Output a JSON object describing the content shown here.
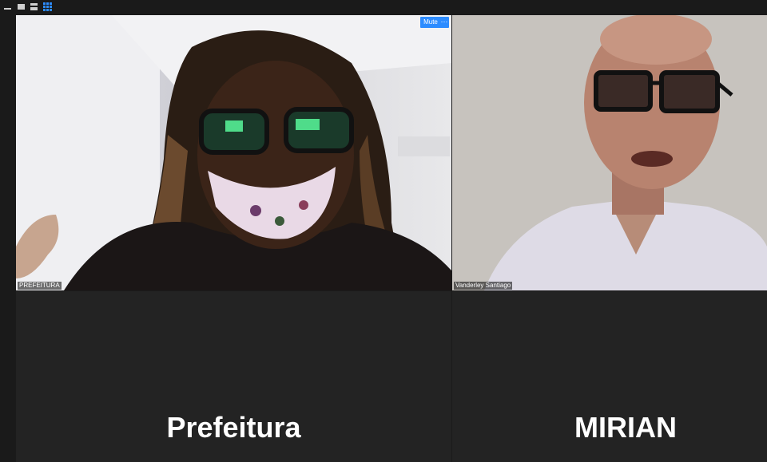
{
  "toolbar": {
    "icons": [
      "minimize-icon",
      "speaker-view-icon",
      "strip-view-icon",
      "gallery-view-icon"
    ]
  },
  "participants": [
    {
      "id": "p1",
      "label": "PREFEITURA",
      "video": true,
      "active_speaker": true,
      "hover_controls": {
        "mute_label": "Mute",
        "more_label": "···"
      }
    },
    {
      "id": "p2",
      "label": "Vanderley Santiago",
      "video": true,
      "active_speaker": false
    },
    {
      "id": "p3",
      "display_name": "Prefeitura",
      "video": false
    },
    {
      "id": "p4",
      "display_name": "MIRIAN",
      "video": false
    }
  ],
  "colors": {
    "background": "#1a1a1a",
    "tile_background": "#232323",
    "active_border": "#c8d96a",
    "accent": "#2d8cff"
  }
}
